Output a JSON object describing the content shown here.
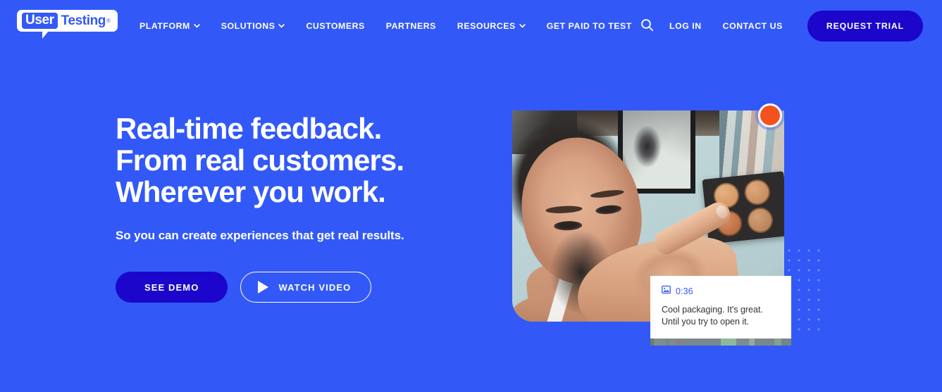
{
  "theme": {
    "background": "#3259f7",
    "accent_dark": "#1c06cb",
    "record_dot": "#f4511e",
    "text_on_blue": "#ffffff",
    "caption_link": "#3259f7",
    "caption_text": "#2f3437",
    "dot_grid": "#7c96fa"
  },
  "header": {
    "logo": {
      "word_badge": "User",
      "word_plain": "Testing",
      "trademark": "®"
    },
    "nav": [
      {
        "label": "PLATFORM",
        "has_caret": true
      },
      {
        "label": "SOLUTIONS",
        "has_caret": true
      },
      {
        "label": "CUSTOMERS",
        "has_caret": false
      },
      {
        "label": "PARTNERS",
        "has_caret": false
      },
      {
        "label": "RESOURCES",
        "has_caret": true
      },
      {
        "label": "GET PAID TO TEST",
        "has_caret": false
      }
    ],
    "search_icon": "search-icon",
    "login_label": "LOG IN",
    "contact_label": "CONTACT US",
    "trial_label": "REQUEST TRIAL"
  },
  "hero": {
    "title_lines": [
      "Real-time feedback.",
      "From real customers.",
      "Wherever you work."
    ],
    "subtitle": "So you can create experiences that get real results.",
    "primary_cta": "SEE DEMO",
    "secondary_cta": "WATCH VIDEO",
    "play_icon": "play-icon"
  },
  "media": {
    "record_indicator": "record-dot",
    "caption": {
      "icon": "screenshot-icon",
      "timestamp": "0:36",
      "lines": [
        "Cool packaging. It's great.",
        "Until you try to open it."
      ]
    }
  }
}
